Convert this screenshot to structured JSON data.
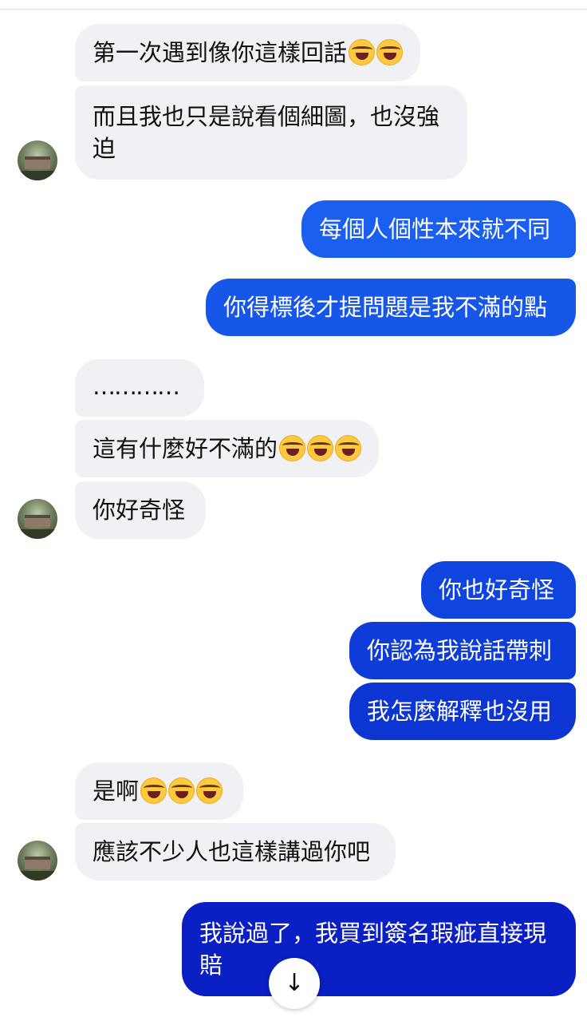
{
  "messages": [
    {
      "id": "m1",
      "dir": "in",
      "text": "第一次遇到像你這樣回話",
      "emoji": 2
    },
    {
      "id": "m2",
      "dir": "in",
      "lines": [
        "而且我也只是說看個細圖，也沒強",
        "迫"
      ]
    },
    {
      "id": "m3",
      "dir": "out",
      "text": "每個人個性本來就不同",
      "color": "#1a5ff0"
    },
    {
      "id": "m4",
      "dir": "out",
      "text": "你得標後才提問題是我不滿的點",
      "color": "#1657ea"
    },
    {
      "id": "m5",
      "dir": "in",
      "text": "…………"
    },
    {
      "id": "m6",
      "dir": "in",
      "text": "這有什麼好不滿的",
      "emoji": 3
    },
    {
      "id": "m7",
      "dir": "in",
      "text": "你好奇怪"
    },
    {
      "id": "m8",
      "dir": "out",
      "text": "你也好奇怪",
      "color": "#0f45de"
    },
    {
      "id": "m9",
      "dir": "out",
      "text": "你認為我說話帶刺",
      "color": "#0e3cd8"
    },
    {
      "id": "m10",
      "dir": "out",
      "text": "我怎麼解釋也沒用",
      "color": "#0d35d2"
    },
    {
      "id": "m11",
      "dir": "in",
      "text": "是啊",
      "emoji": 3
    },
    {
      "id": "m12",
      "dir": "in",
      "text": "應該不少人也這樣講過你吧"
    },
    {
      "id": "m13",
      "dir": "out",
      "lines": [
        "我說過了，我買到簽名瑕疵直接現",
        "賠"
      ],
      "color": "#0a1fc4"
    }
  ],
  "icons": {
    "emoji": "face-with-tears-of-joy-icon",
    "scroll": "arrow-down-icon",
    "avatar": "contact-avatar"
  },
  "scroll_button": {
    "glyph": "↓"
  }
}
